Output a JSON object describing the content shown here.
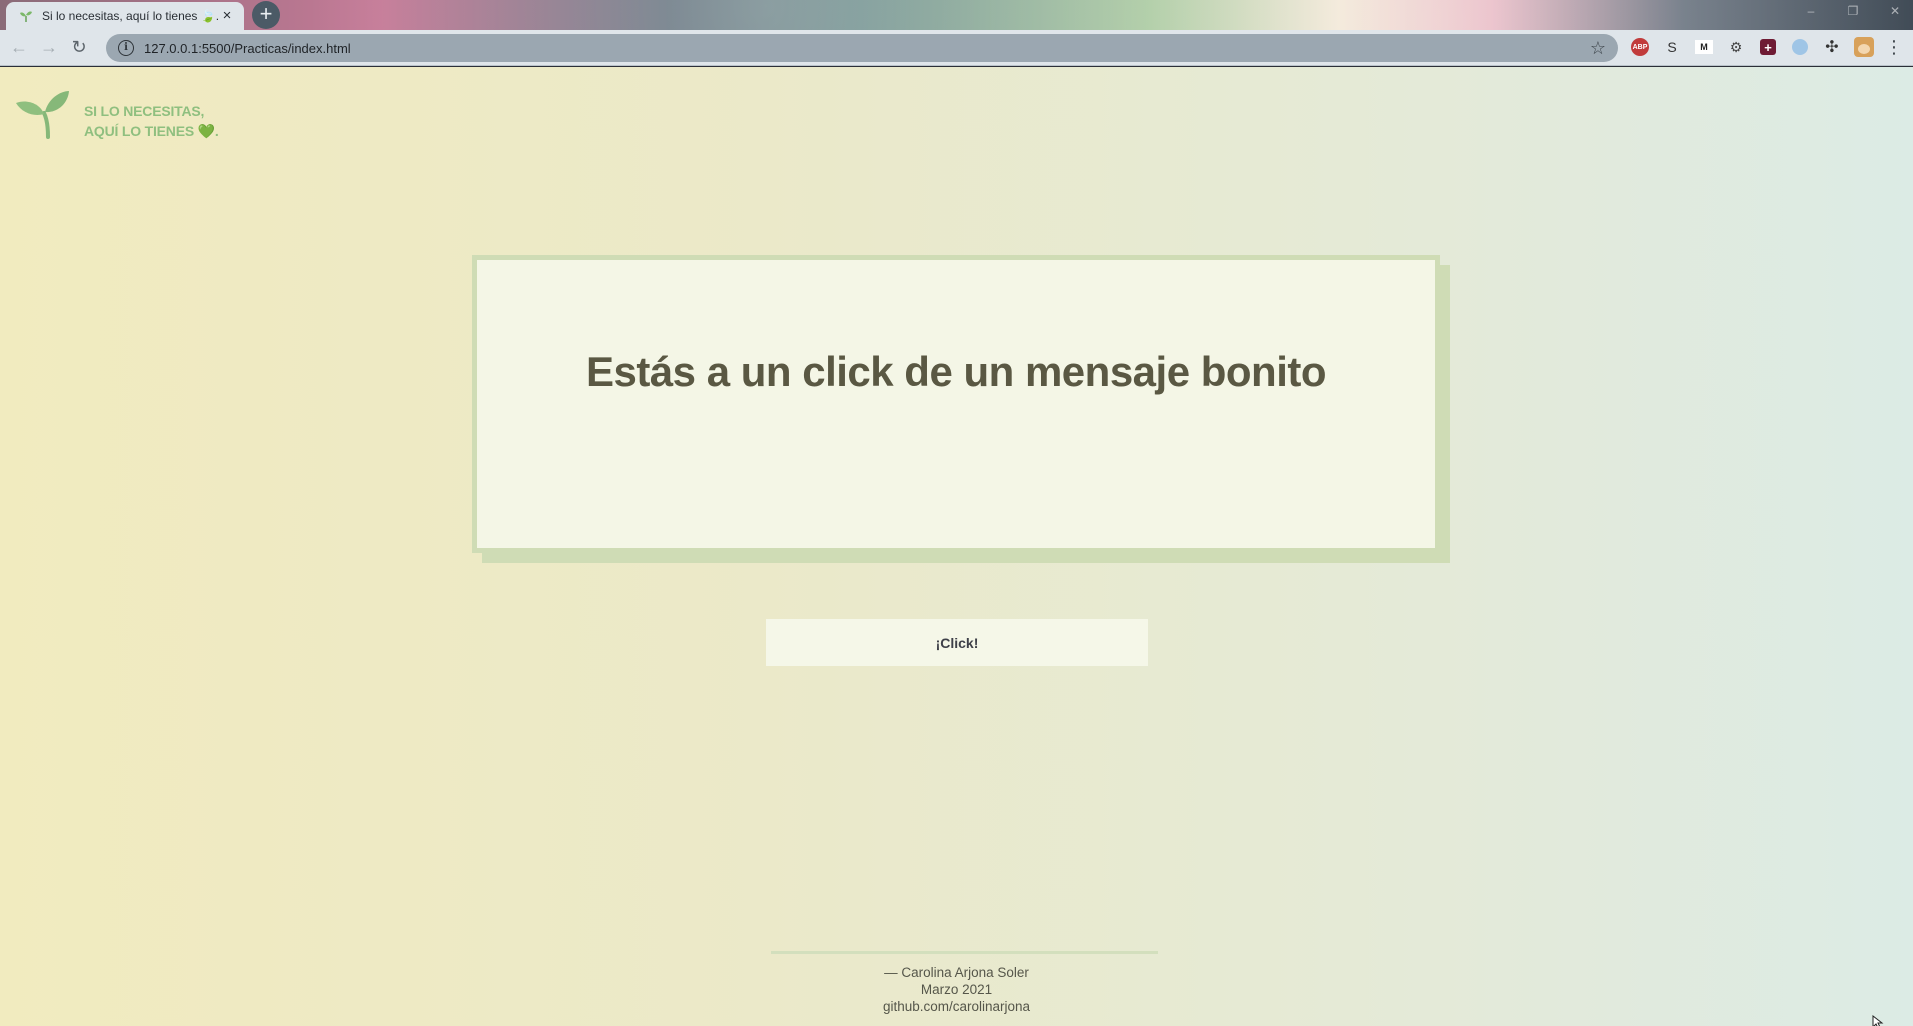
{
  "browser": {
    "tab_title": "Si lo necesitas, aquí lo tienes 🍃.",
    "tab_close": "×",
    "new_tab": "+",
    "url": "127.0.0.1:5500/Practicas/index.html",
    "extensions": {
      "abp": "ABP",
      "s": "S",
      "m": "M"
    },
    "icons": [
      "back-arrow-icon",
      "forward-arrow-icon",
      "reload-icon",
      "info-icon",
      "star-icon",
      "puzzle-icon",
      "menu-icon"
    ]
  },
  "header": {
    "logo_line1": "SI LO NECESITAS,",
    "logo_line2": "AQUÍ LO TIENES 💚.",
    "logo_icon": "sprout-icon"
  },
  "card": {
    "title": "Estás a un click de un mensaje bonito"
  },
  "button": {
    "label": "¡Click!"
  },
  "footer": {
    "author": "— Carolina Arjona Soler",
    "date": "Marzo 2021",
    "github": "github.com/carolinarjona"
  },
  "colors": {
    "accent_green": "#8fbf7f",
    "card_bg": "#f4f6e6",
    "card_border": "#cfdcb5",
    "title_text": "#5a5843"
  }
}
